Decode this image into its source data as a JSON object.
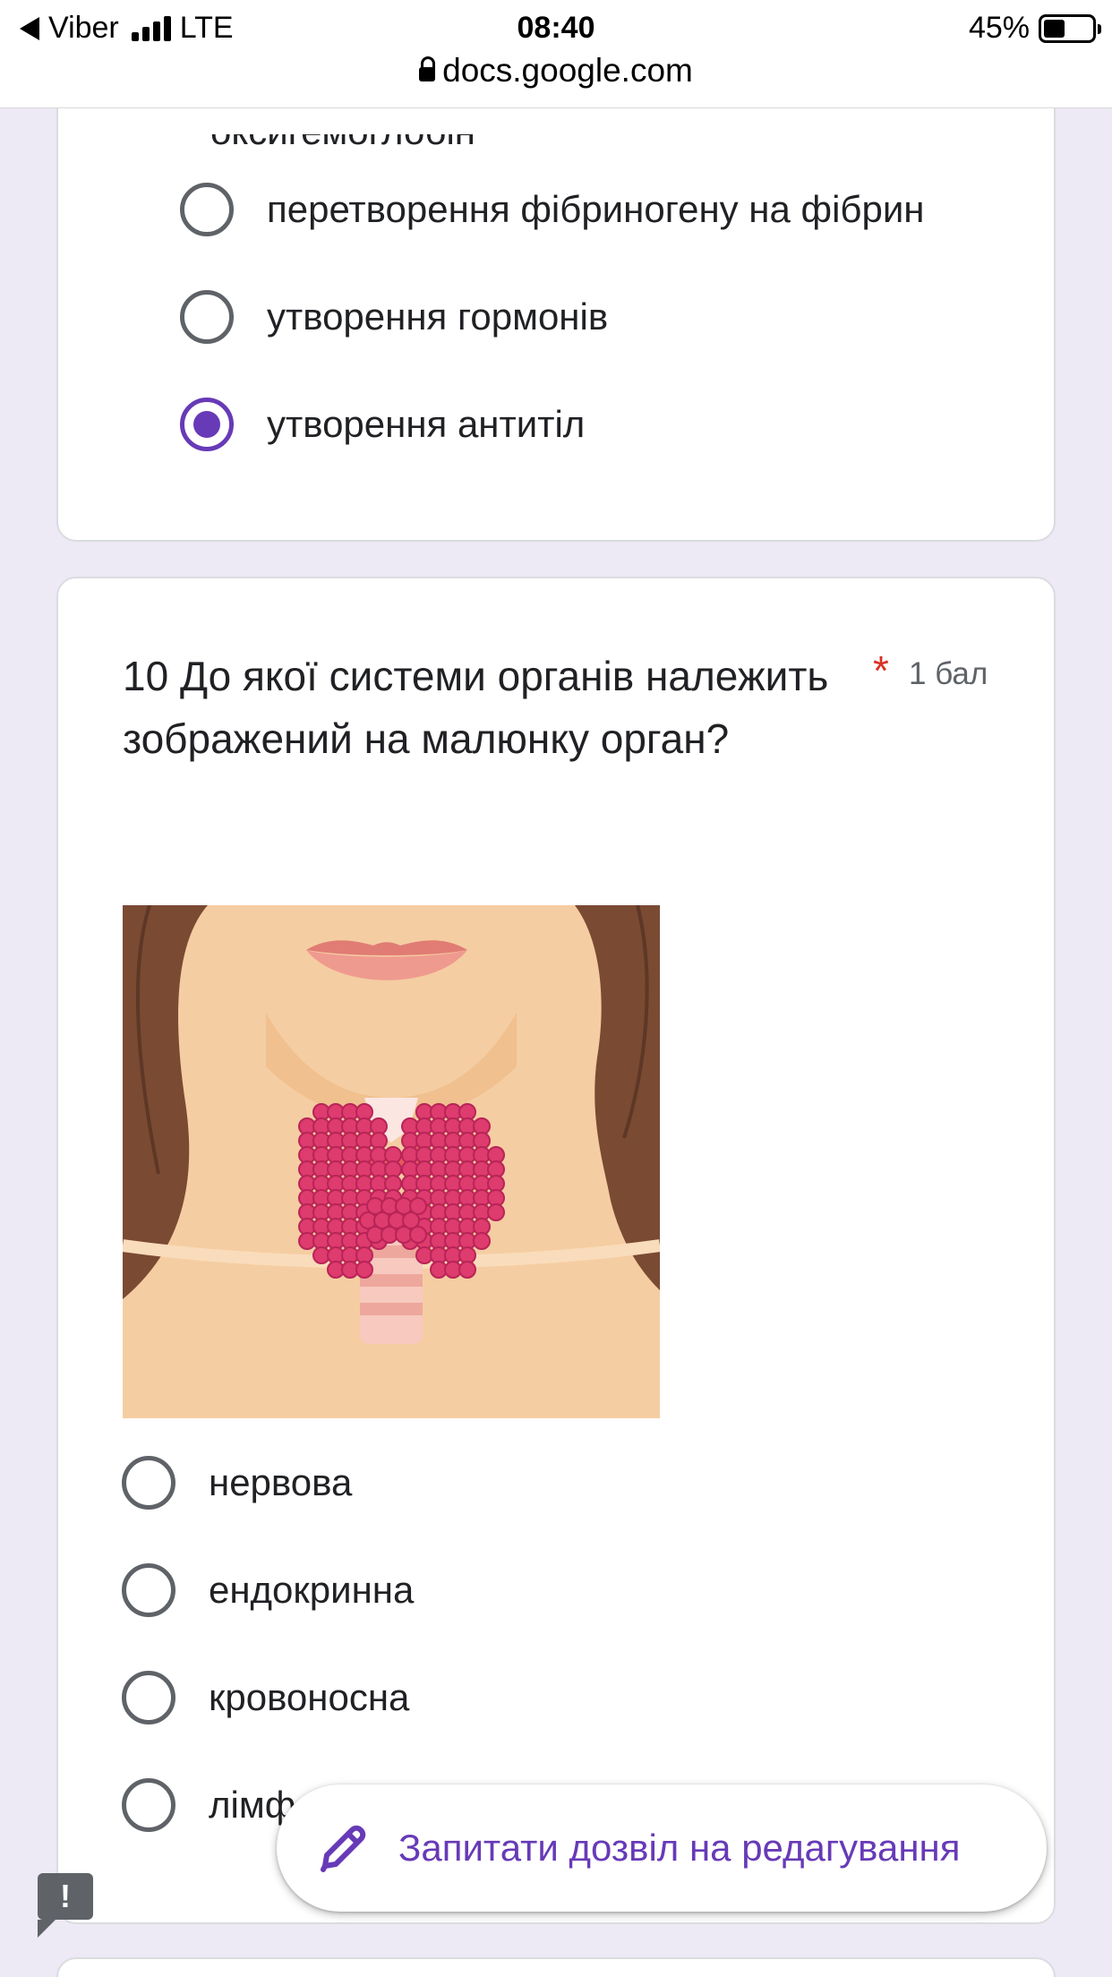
{
  "status_bar": {
    "carrier": "Viber",
    "network": "LTE",
    "time": "08:40",
    "battery": "45%",
    "battery_level": 0.45
  },
  "url": "docs.google.com",
  "prev_question": {
    "partial_text": "оксигемоглобін",
    "options": [
      {
        "label": "перетворення фібриногену на фібрин",
        "selected": false
      },
      {
        "label": "утворення гормонів",
        "selected": false
      },
      {
        "label": "утворення антитіл",
        "selected": true
      }
    ]
  },
  "question": {
    "text": "10 До якої системи органів належить зображений на малюнку орган?",
    "required_mark": "*",
    "points": "1 бал",
    "options": [
      {
        "label": "нервова",
        "selected": false
      },
      {
        "label": "ендокринна",
        "selected": false
      },
      {
        "label": "кровоносна",
        "selected": false
      },
      {
        "label": "лімф",
        "selected": false
      }
    ]
  },
  "fab": {
    "label": "Запитати дозвіл на редагування"
  },
  "feedback": {
    "symbol": "!"
  },
  "colors": {
    "accent": "#673ab7",
    "background": "#ede9f5",
    "required": "#d93025"
  }
}
